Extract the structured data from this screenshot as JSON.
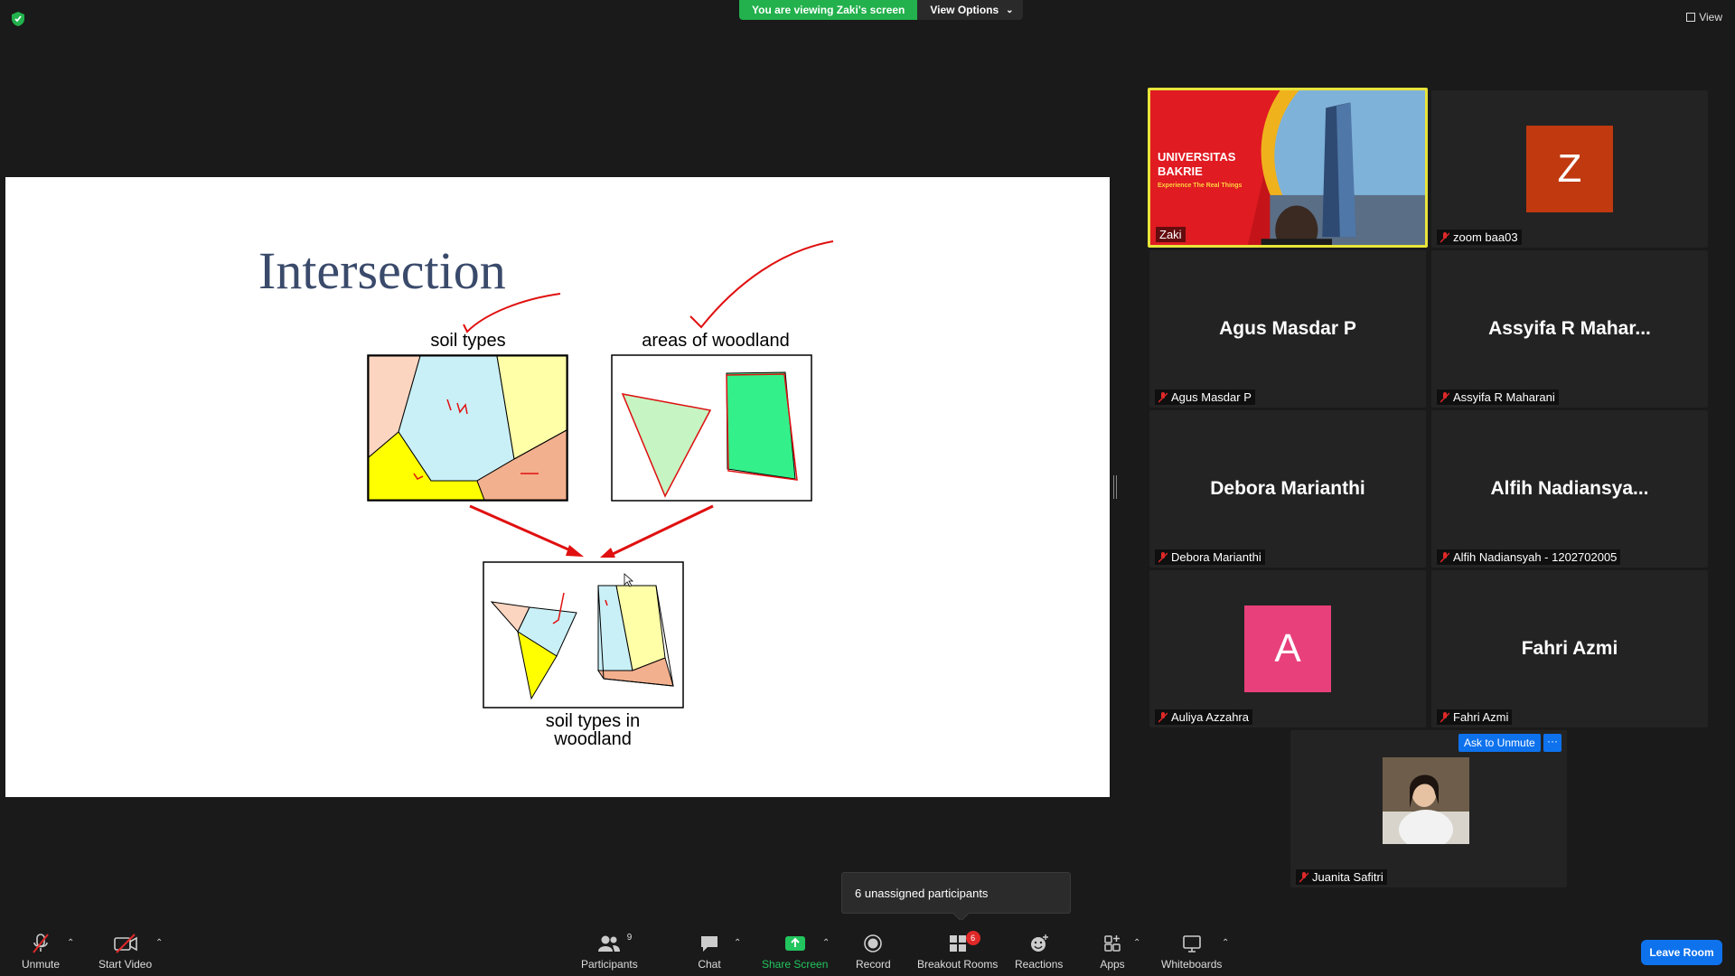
{
  "banner": {
    "viewing_text": "You are viewing Zaki's screen",
    "view_options_label": "View Options"
  },
  "top_right": {
    "view_label": "View"
  },
  "slide": {
    "title": "Intersection",
    "label_soil": "soil types",
    "label_woodland": "areas of woodland",
    "label_result_line1": "soil types in",
    "label_result_line2": "woodland"
  },
  "participants": [
    {
      "id": "zaki",
      "display": "",
      "nametag": "Zaki",
      "muted": false,
      "video": true
    },
    {
      "id": "zoom-baa03",
      "display": "Z",
      "nametag": "zoom baa03",
      "muted": true,
      "avatar_color": "#c0390f"
    },
    {
      "id": "agus",
      "display": "Agus Masdar P",
      "nametag": "Agus Masdar P",
      "muted": true
    },
    {
      "id": "assyifa",
      "display": "Assyifa R Mahar...",
      "nametag": "Assyifa R Maharani",
      "muted": true
    },
    {
      "id": "debora",
      "display": "Debora Marianthi",
      "nametag": "Debora Marianthi",
      "muted": true
    },
    {
      "id": "alfih",
      "display": "Alfih  Nadiansya...",
      "nametag": "Alfih Nadiansyah - 1202702005",
      "muted": true
    },
    {
      "id": "auliya",
      "display": "A",
      "nametag": "Auliya Azzahra",
      "muted": true,
      "avatar_color": "#e8407a"
    },
    {
      "id": "fahri",
      "display": "Fahri Azmi",
      "nametag": "Fahri Azmi",
      "muted": true
    },
    {
      "id": "juanita",
      "display": "",
      "nametag": "Juanita Safitri",
      "muted": true,
      "video": true
    }
  ],
  "zaki_video": {
    "brand_line1": "UNIVERSITAS",
    "brand_line2": "BAKRIE",
    "tagline": "Experience The Real Things"
  },
  "ask_unmute_label": "Ask to Unmute",
  "more_label": "···",
  "tooltip": "6 unassigned participants",
  "toolbar": {
    "unmute": "Unmute",
    "start_video": "Start Video",
    "participants": "Participants",
    "participants_count": "9",
    "chat": "Chat",
    "share_screen": "Share Screen",
    "record": "Record",
    "breakout_rooms": "Breakout Rooms",
    "breakout_count": "6",
    "reactions": "Reactions",
    "apps": "Apps",
    "whiteboards": "Whiteboards",
    "leave_room": "Leave Room"
  },
  "colors": {
    "accent": "#0e72ed",
    "share_green": "#22b14c",
    "active_speaker": "#e8e43a",
    "leave": "#0e72ed"
  }
}
